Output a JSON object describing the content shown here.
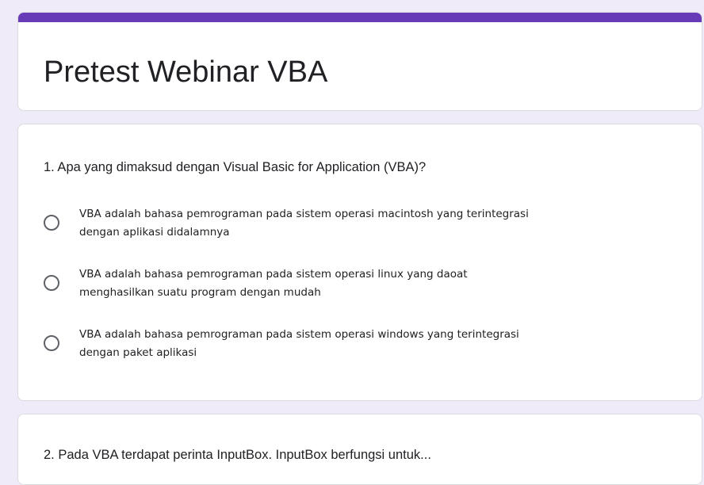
{
  "form": {
    "title": "Pretest Webinar VBA",
    "accent_color": "#673ab7",
    "background_color": "#f0ebf8"
  },
  "questions": [
    {
      "text": "1. Apa yang dimaksud dengan Visual Basic for Application (VBA)?",
      "options": [
        {
          "line1": "VBA adalah bahasa pemrograman pada sistem operasi macintosh yang terintegrasi",
          "line2": "dengan aplikasi didalamnya"
        },
        {
          "line1": "VBA adalah bahasa pemrograman pada sistem operasi linux yang daoat",
          "line2": "menghasilkan suatu program dengan mudah"
        },
        {
          "line1": "VBA adalah bahasa pemrograman pada sistem operasi windows yang terintegrasi",
          "line2": "dengan paket aplikasi"
        }
      ]
    },
    {
      "text": "2. Pada VBA terdapat perinta InputBox. InputBox berfungsi untuk..."
    }
  ]
}
